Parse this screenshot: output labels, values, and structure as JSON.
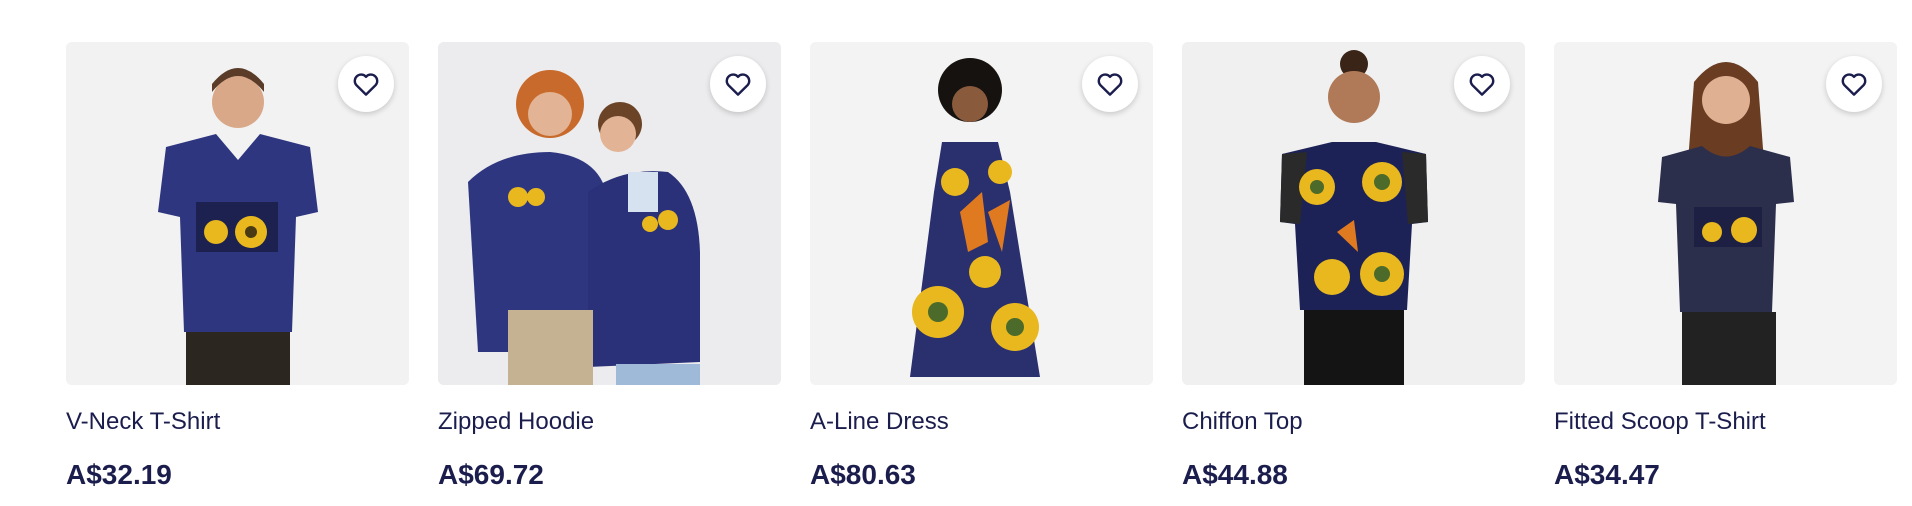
{
  "products": [
    {
      "title": "V-Neck T-Shirt",
      "price": "A$32.19",
      "image": "v-neck-tshirt-photo"
    },
    {
      "title": "Zipped Hoodie",
      "price": "A$69.72",
      "image": "zipped-hoodie-photo"
    },
    {
      "title": "A-Line Dress",
      "price": "A$80.63",
      "image": "a-line-dress-photo"
    },
    {
      "title": "Chiffon Top",
      "price": "A$44.88",
      "image": "chiffon-top-photo"
    },
    {
      "title": "Fitted Scoop T-Shirt",
      "price": "A$34.47",
      "image": "fitted-scoop-tshirt-photo"
    }
  ],
  "icons": {
    "favorite": "heart-outline-icon"
  },
  "colors": {
    "text": "#1b1d4d",
    "navy": "#2f3680",
    "sunflower": "#e8b81e",
    "image_bg": "#f0f0f0"
  }
}
